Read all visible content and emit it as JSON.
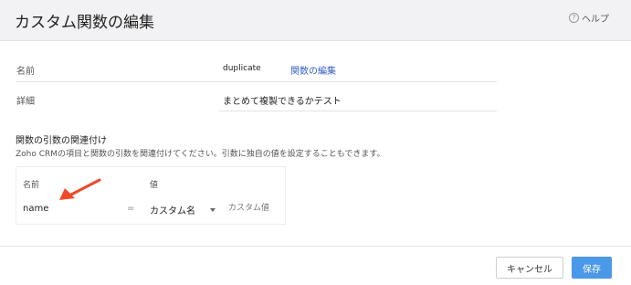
{
  "header": {
    "title": "カスタム関数の編集",
    "help_label": "ヘルプ",
    "help_icon": "?"
  },
  "form": {
    "name_label": "名前",
    "function_name": "duplicate",
    "edit_function_link": "関数の編集",
    "description_label": "詳細",
    "description_value": "まとめて複製できるかテスト"
  },
  "mapping": {
    "title": "関数の引数の関連付け",
    "description": "Zoho CRMの項目と関数の引数を関連付けてください。引数に独自の値を設定することもできます。",
    "col_name": "名前",
    "col_value": "値",
    "rows": [
      {
        "arg_name": "name",
        "equals": "=",
        "field_select": "カスタム名",
        "custom_value_placeholder": "カスタム値"
      }
    ]
  },
  "footer": {
    "cancel_label": "キャンセル",
    "save_label": "保存"
  },
  "colors": {
    "header_bg": "#f2f2f4",
    "link": "#2f5ec4",
    "save_button": "#4a98e8",
    "annotation_arrow": "#ee4a2a"
  }
}
